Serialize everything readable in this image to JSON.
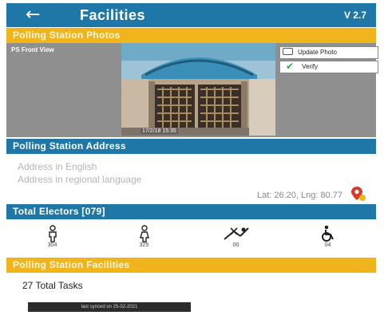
{
  "header": {
    "back_icon": "arrow-left-icon",
    "title": "Facilities",
    "version": "V 2.7"
  },
  "photos_section": {
    "title": "Polling Station Photos",
    "photo_label": "PS Front View",
    "photo_caption": "17/2/18 15:35",
    "update_photo_label": "Update Photo",
    "verify_label": "Verify"
  },
  "address_section": {
    "title": "Polling Station Address",
    "address_english": "Address in English",
    "address_regional": "Address in regional language",
    "coordinates": "Lat: 26.20, Lng: 80.77"
  },
  "electors_section": {
    "title": "Total Electors [079]",
    "categories": [
      {
        "icon": "male-voter-icon",
        "count": "304"
      },
      {
        "icon": "female-voter-icon",
        "count": "325"
      },
      {
        "icon": "third-gender-icon",
        "count": "00"
      },
      {
        "icon": "pwd-wheelchair-icon",
        "count": "04"
      }
    ]
  },
  "facilities_section": {
    "title": "Polling Station Facilities",
    "total_tasks": "27 Total Tasks",
    "last_synced": "last synced on 25-02-2021"
  },
  "colors": {
    "primary_blue": "#1f77a7",
    "accent_yellow": "#f0b51c",
    "verify_green": "#23a845",
    "pin_red": "#d83a2b"
  }
}
